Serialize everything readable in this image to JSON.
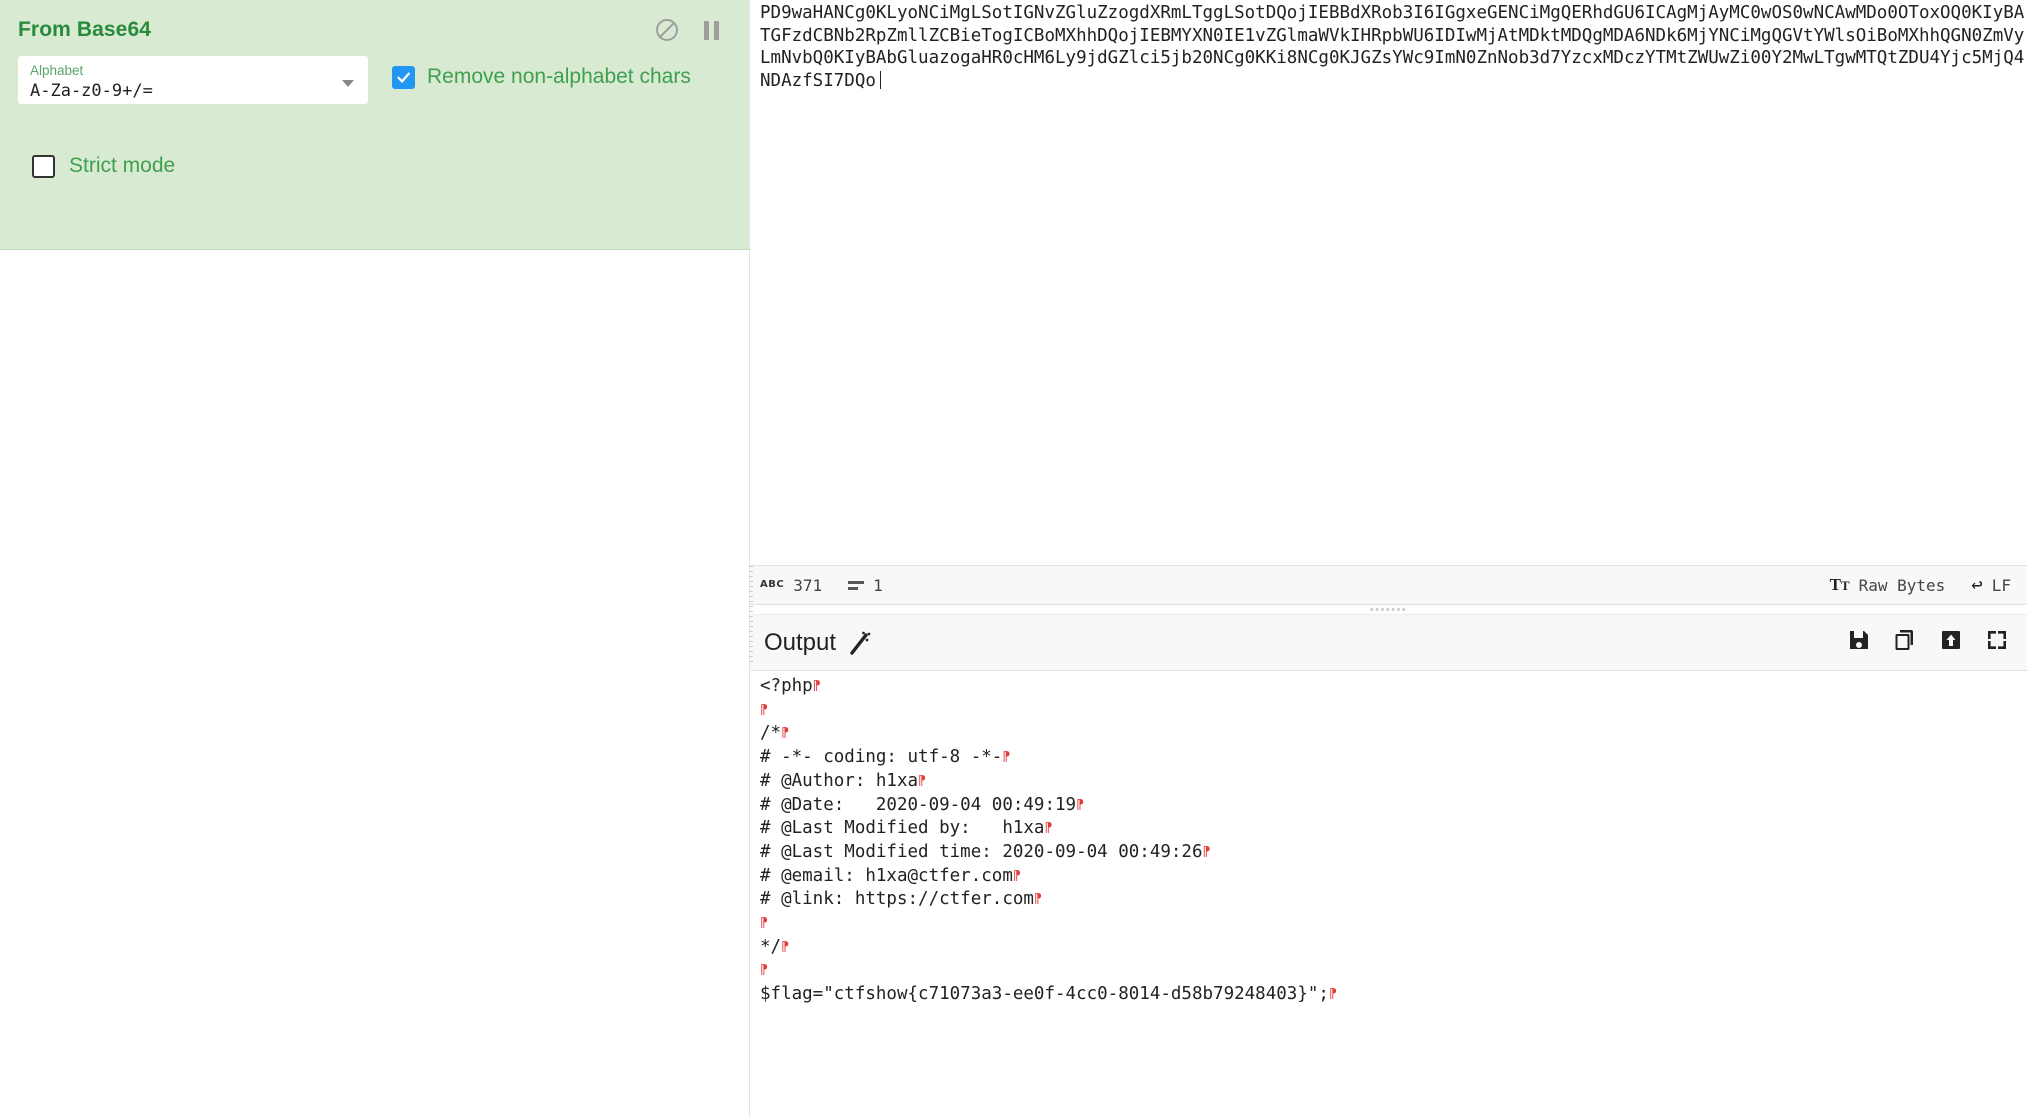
{
  "recipe": {
    "operation": {
      "title": "From Base64",
      "disable_icon": "circle-slash-icon",
      "pause_icon": "pause-icon",
      "args": {
        "alphabet_label": "Alphabet",
        "alphabet_value": "A-Za-z0-9+/=",
        "remove_non_alphabet_label": "Remove non-alphabet chars",
        "remove_non_alphabet_checked": "true",
        "strict_mode_label": "Strict mode",
        "strict_mode_checked": "false"
      }
    }
  },
  "input": {
    "text": "PD9waHANCg0KLyoNCiMgLSotIGNvZGluZzogdXRmLTggLSotDQojIEBBdXRob3I6IGgxeGENCiMgQERhdGU6ICAgMjAyMC0wOS0wNCAwMDo0OToxOQ0KIyBATGFzdCBNb2RpZmllZCBieTogICBoMXhhDQojIEBMYXN0IE1vZGlmaWVkIHRpbWU6IDIwMjAtMDktMDQgMDA6NDk6MjYNCiMgQGVtYWlsOiBoMXhhQGN0ZmVyLmNvbQ0KIyBAbGluazogaHR0cHM6Ly9jdGZlci5jb20NCg0KKi8NCg0KJGZsYWc9ImN0ZnNob3d7YzcxMDczYTMtZWUwZi00Y2MwLTgwMTQtZDU4Yjc5MjQ4NDAzfSI7DQo"
  },
  "status_bar": {
    "length_icon": "abc-icon",
    "length": "371",
    "lines_icon": "line-count-icon",
    "lines": "1",
    "encoding_icon": "font-icon",
    "encoding": "Raw Bytes",
    "eol_icon": "carriage-return-icon",
    "eol": "LF"
  },
  "output": {
    "title": "Output",
    "magic_icon": "magic-wand-icon",
    "save_icon": "save-icon",
    "copy_icon": "copy-icon",
    "bake-to-input_icon": "replace-input-icon",
    "maximise_icon": "maximise-icon",
    "lines": [
      "<?php",
      "",
      "/*",
      "# -*- coding: utf-8 -*-",
      "# @Author: h1xa",
      "# @Date:   2020-09-04 00:49:19",
      "# @Last Modified by:   h1xa",
      "# @Last Modified time: 2020-09-04 00:49:26",
      "# @email: h1xa@ctfer.com",
      "# @link: https://ctfer.com",
      "",
      "*/",
      "",
      "$flag=\"ctfshow{c71073a3-ee0f-4cc0-8014-d58b79248403}\";"
    ]
  },
  "colors": {
    "operation_bg": "#d9ead3",
    "operation_title": "#288b3b",
    "label_green": "#5aa469",
    "checkbox_blue": "#2196f3",
    "cr_marker": "#e23b3b"
  }
}
